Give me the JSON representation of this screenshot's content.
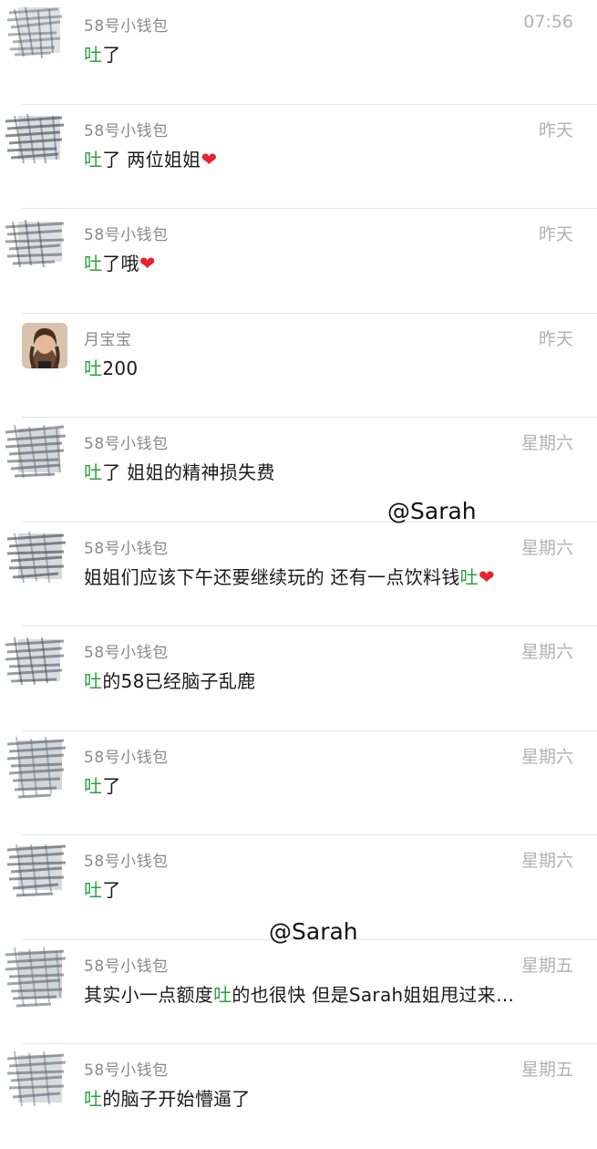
{
  "conversations": [
    {
      "avatar_icon": "scribbled-avatar-icon",
      "name": "58号小钱包",
      "time": "07:56",
      "hl_before": "",
      "hl": "吐",
      "after": "了",
      "heart": ""
    },
    {
      "avatar_icon": "scribbled-avatar-icon",
      "name": "58号小钱包",
      "time": "昨天",
      "hl_before": "",
      "hl": "吐",
      "after": "了 两位姐姐",
      "heart": "❤"
    },
    {
      "avatar_icon": "scribbled-avatar-icon",
      "name": "58号小钱包",
      "time": "昨天",
      "hl_before": "",
      "hl": "吐",
      "after": "了哦",
      "heart": "❤"
    },
    {
      "avatar_icon": "portrait-avatar-icon",
      "name": "月宝宝",
      "time": "昨天",
      "hl_before": "",
      "hl": "吐",
      "after": "200",
      "heart": ""
    },
    {
      "avatar_icon": "scribbled-avatar-icon",
      "name": "58号小钱包",
      "time": "星期六",
      "hl_before": "",
      "hl": "吐",
      "after": "了 姐姐的精神损失费",
      "heart": ""
    },
    {
      "avatar_icon": "scribbled-avatar-icon",
      "name": "58号小钱包",
      "time": "星期六",
      "hl_before": "姐姐们应该下午还要继续玩的 还有一点饮料钱",
      "hl": "吐",
      "after": "",
      "heart": "❤"
    },
    {
      "avatar_icon": "scribbled-avatar-icon",
      "name": "58号小钱包",
      "time": "星期六",
      "hl_before": "",
      "hl": "吐",
      "after": "的58已经脑子乱鹿",
      "heart": ""
    },
    {
      "avatar_icon": "scribbled-avatar-icon",
      "name": "58号小钱包",
      "time": "星期六",
      "hl_before": "",
      "hl": "吐",
      "after": "了",
      "heart": ""
    },
    {
      "avatar_icon": "scribbled-avatar-icon",
      "name": "58号小钱包",
      "time": "星期六",
      "hl_before": "",
      "hl": "吐",
      "after": "了",
      "heart": ""
    },
    {
      "avatar_icon": "scribbled-avatar-icon",
      "name": "58号小钱包",
      "time": "星期五",
      "hl_before": "其实小一点额度",
      "hl": "吐",
      "after": "的也很快 但是Sarah姐姐甩过来…",
      "heart": ""
    },
    {
      "avatar_icon": "scribbled-avatar-icon",
      "name": "58号小钱包",
      "time": "星期五",
      "hl_before": "",
      "hl": "吐",
      "after": "的脑子开始懵逼了",
      "heart": ""
    }
  ],
  "watermarks": [
    {
      "text": "@Sarah"
    },
    {
      "text": "@Sarah"
    }
  ],
  "colors": {
    "highlight": "#2ba245",
    "name_gray": "#8a8a8a",
    "time_gray": "#b2b2b2",
    "divider": "#e6e6e6",
    "heart": "#e8222e"
  }
}
